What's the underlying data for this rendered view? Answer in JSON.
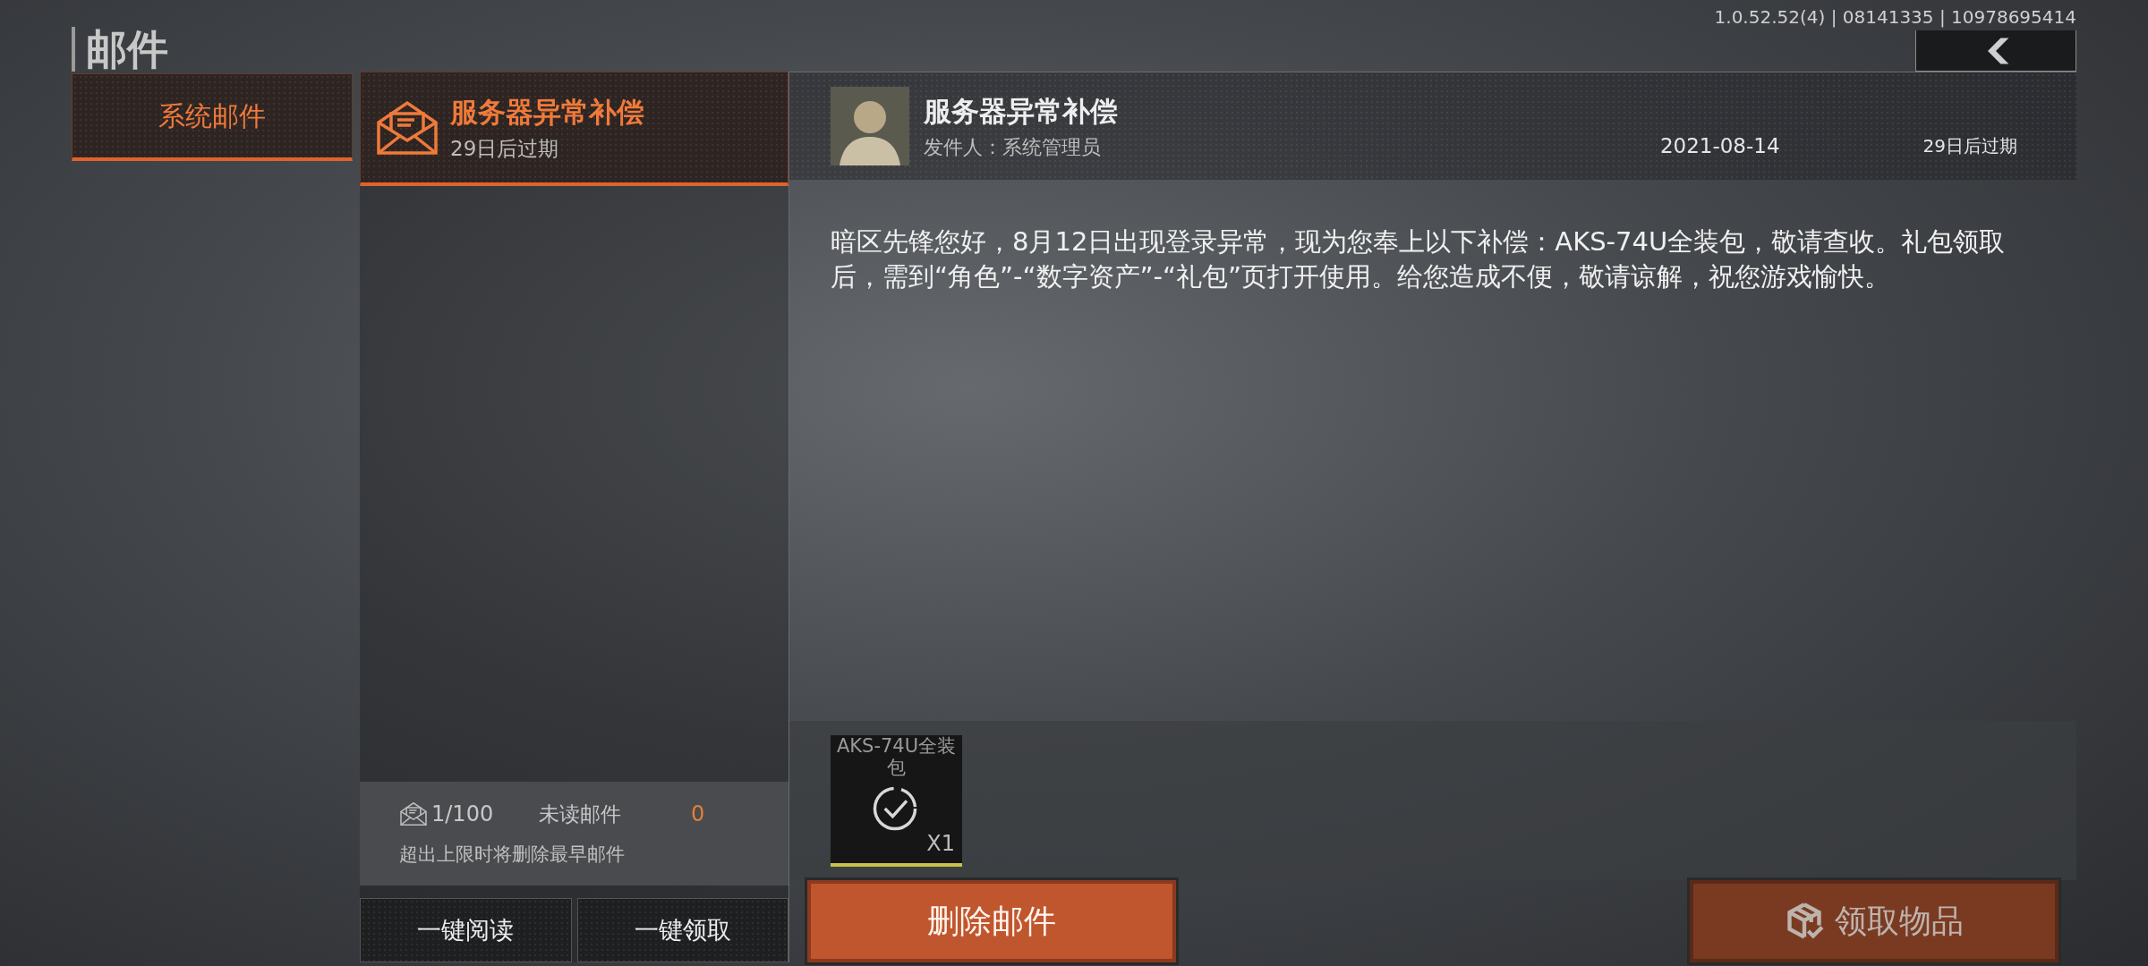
{
  "header": {
    "title": "邮件",
    "version": "1.0.52.52(4) | 08141335 | 10978695414"
  },
  "categories": [
    {
      "label": "系统邮件",
      "selected": true
    }
  ],
  "mails": [
    {
      "subject": "服务器异常补偿",
      "expiry": "29日后过期",
      "selected": true
    }
  ],
  "mailbox": {
    "count": "1/100",
    "unread_label": "未读邮件",
    "unread_count": "0",
    "notice": "超出上限时将删除最早邮件"
  },
  "list_buttons": [
    "一键阅读",
    "一键领取"
  ],
  "detail": {
    "subject": "服务器异常补偿",
    "sender": "发件人：系统管理员",
    "date": "2021-08-14",
    "expiry": "29日后过期",
    "body": "暗区先锋您好，8月12日出现登录异常，现为您奉上以下补偿：AKS-74U全装包，敬请查收。礼包领取后，需到“角色”-“数字资产”-“礼包”页打开使用。给您造成不便，敬请谅解，祝您游戏愉快。",
    "attachments": [
      {
        "name": "AKS-74U全装包",
        "quantity": "X1",
        "claimed": true
      }
    ]
  },
  "actions": [
    {
      "label": "删除邮件",
      "kind": "delete",
      "disabled": false
    },
    {
      "label": "领取物品",
      "kind": "claim",
      "disabled": true
    }
  ]
}
